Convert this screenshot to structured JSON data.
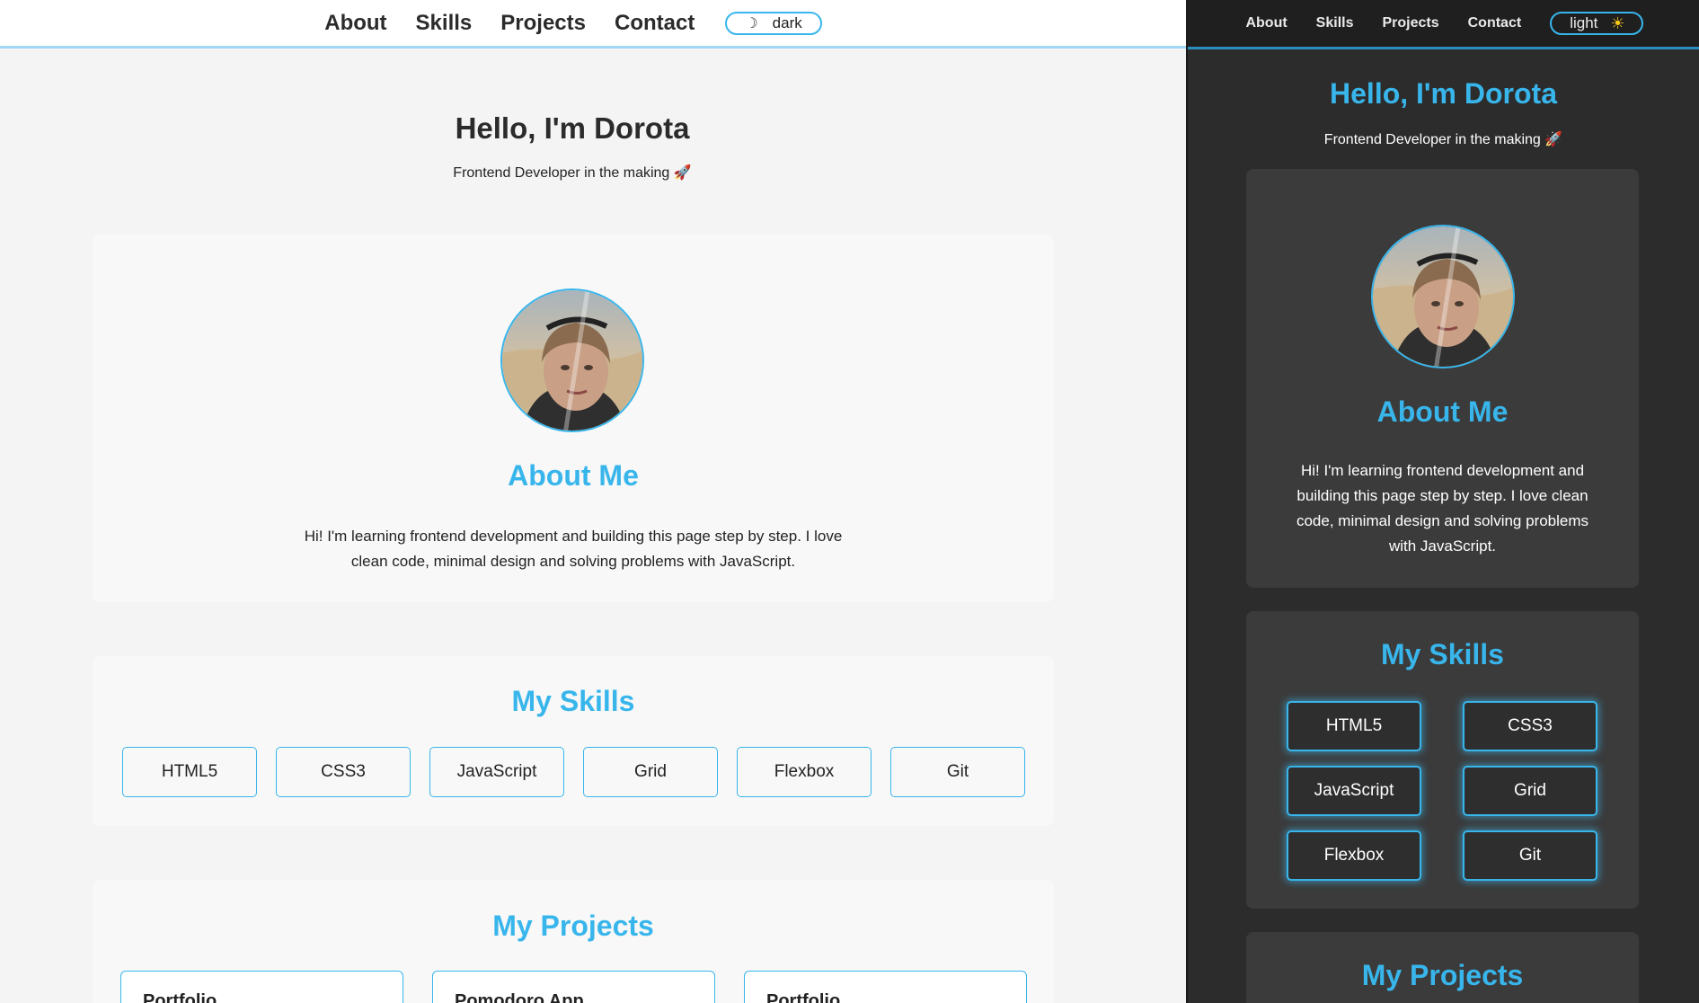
{
  "nav": {
    "links": [
      "About",
      "Skills",
      "Projects",
      "Contact"
    ]
  },
  "theme_toggle": {
    "light_mode_label": "dark",
    "light_mode_icon": "moon-icon",
    "dark_mode_label": "light",
    "dark_mode_icon": "sun-icon"
  },
  "hero": {
    "title": "Hello, I'm Dorota",
    "tagline": "Frontend Developer in the making 🚀"
  },
  "about": {
    "heading": "About Me",
    "text": "Hi! I'm learning frontend development and building this page step by step. I love clean code, minimal design and solving problems with JavaScript."
  },
  "skills": {
    "heading": "My Skills",
    "items": [
      "HTML5",
      "CSS3",
      "JavaScript",
      "Grid",
      "Flexbox",
      "Git"
    ]
  },
  "projects": {
    "heading": "My Projects",
    "items": [
      "Portfolio",
      "Pomodoro App",
      "Portfolio"
    ]
  },
  "colors": {
    "accent": "#38b6ec",
    "light_bg": "#f4f4f4",
    "dark_bg": "#2c2c2c",
    "dark_card": "#3b3b3b"
  }
}
